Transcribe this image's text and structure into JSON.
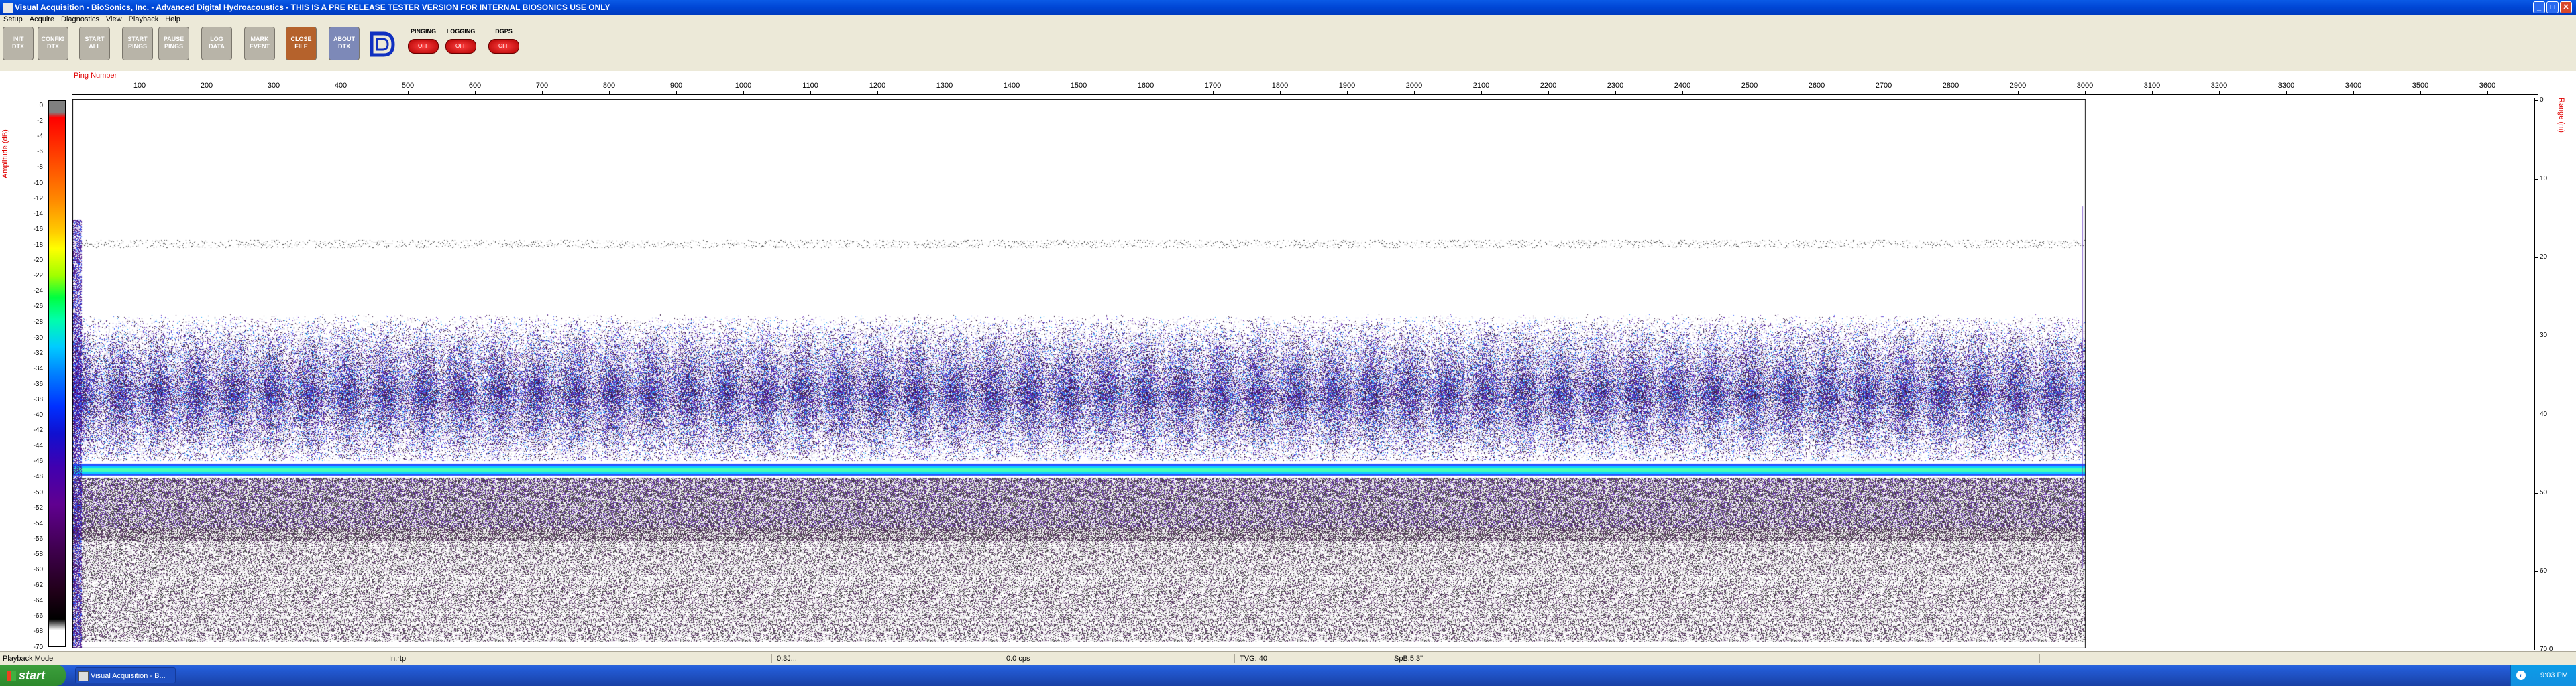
{
  "window": {
    "title": "Visual Acquisition  -  BioSonics, Inc.  -  Advanced Digital Hydroacoustics  -  THIS IS A PRE RELEASE TESTER VERSION FOR INTERNAL BIOSONICS USE ONLY",
    "minimize": "_",
    "maximize": "□",
    "close": "✕"
  },
  "menu": [
    "Setup",
    "Acquire",
    "Diagnostics",
    "View",
    "Playback",
    "Help"
  ],
  "toolbar": {
    "buttons": [
      {
        "line1": "INIT",
        "line2": "DTX"
      },
      {
        "line1": "CONFIG",
        "line2": "DTX"
      },
      {
        "line1": "START",
        "line2": "ALL"
      },
      {
        "line1": "START",
        "line2": "PINGS"
      },
      {
        "line1": "PAUSE",
        "line2": "PINGS"
      },
      {
        "line1": "LOG",
        "line2": "DATA"
      },
      {
        "line1": "MARK",
        "line2": "EVENT"
      },
      {
        "line1": "CLOSE",
        "line2": "FILE"
      },
      {
        "line1": "ABOUT",
        "line2": "DTX"
      }
    ],
    "status": [
      {
        "label": "PINGING",
        "led": "OFF"
      },
      {
        "label": "LOGGING",
        "led": "OFF"
      },
      {
        "label": "DGPS",
        "led": "OFF"
      }
    ]
  },
  "echogram": {
    "x_label": "Ping Number",
    "x_ticks": [
      "100",
      "200",
      "300",
      "400",
      "500",
      "600",
      "700",
      "800",
      "900",
      "1000",
      "1100",
      "1200",
      "1300",
      "1400",
      "1500",
      "1600",
      "1700",
      "1800",
      "1900",
      "2000",
      "2100",
      "2200",
      "2300",
      "2400",
      "2500",
      "2600",
      "2700",
      "2800",
      "2900",
      "3000",
      "3100",
      "3200",
      "3300",
      "3400",
      "3500",
      "3600"
    ],
    "amp_label": "Amplitude (dB)",
    "amp_ticks": [
      "0",
      "-2",
      "-4",
      "-6",
      "-8",
      "-10",
      "-12",
      "-14",
      "-16",
      "-18",
      "-20",
      "-22",
      "-24",
      "-26",
      "-28",
      "-30",
      "-32",
      "-34",
      "-36",
      "-38",
      "-40",
      "-42",
      "-44",
      "-46",
      "-48",
      "-50",
      "-52",
      "-54",
      "-56",
      "-58",
      "-60",
      "-62",
      "-64",
      "-66",
      "-68",
      "-70"
    ],
    "range_label": "Range (m)",
    "range_ticks": [
      "0",
      "10",
      "20",
      "30",
      "40",
      "50",
      "60",
      "70.0"
    ],
    "pings_recorded": 3000,
    "range_max": 70,
    "colors": {
      "bottom_line": "#00e0ff",
      "noise": "#4000a0",
      "speckle": "#200020"
    }
  },
  "statusbar": {
    "mode": "Playback Mode",
    "fields": [
      "In.rtp",
      "0.3J...",
      "0.0 cps",
      "TVG: 40",
      "SpB:5.3\""
    ]
  },
  "taskbar": {
    "start": "start",
    "task": "Visual Acquisition - B...",
    "clock": "9:03 PM"
  }
}
